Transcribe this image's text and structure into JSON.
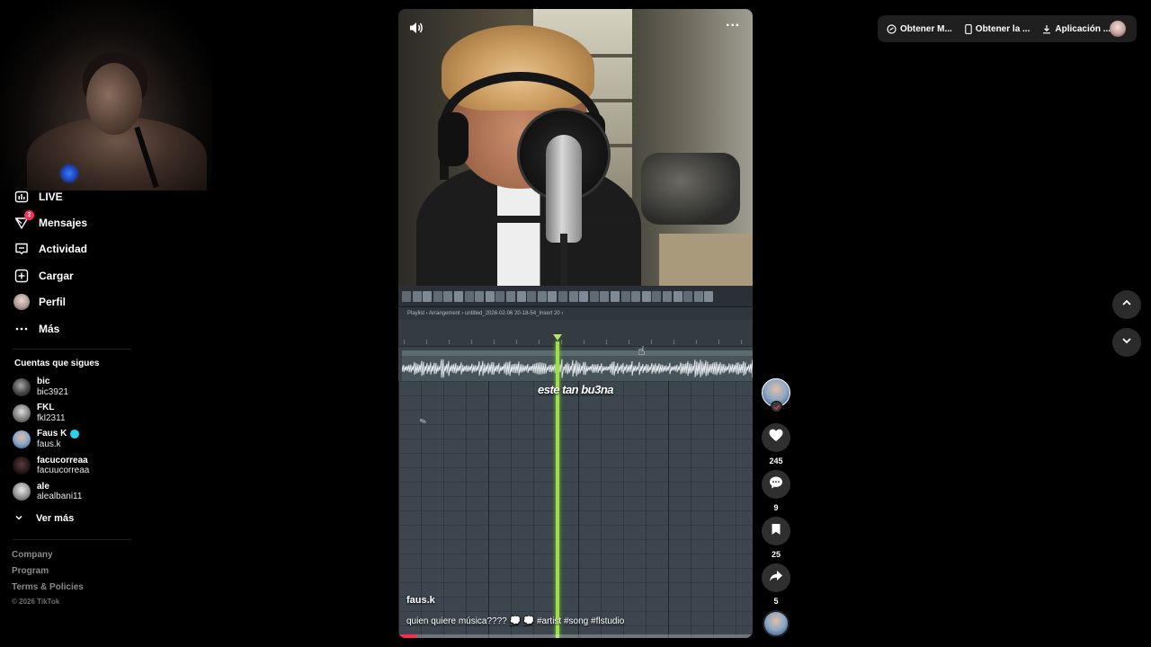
{
  "sidebar": {
    "nav": [
      {
        "label": "LIVE",
        "icon": "live-icon"
      },
      {
        "label": "Mensajes",
        "icon": "messages-icon",
        "badge": "2"
      },
      {
        "label": "Actividad",
        "icon": "activity-icon"
      },
      {
        "label": "Cargar",
        "icon": "upload-icon"
      },
      {
        "label": "Perfil",
        "icon": "profile-avatar"
      },
      {
        "label": "Más",
        "icon": "more-icon"
      }
    ],
    "following_title": "Cuentas que sigues",
    "following": [
      {
        "name": "bic",
        "username": "bic3921",
        "verified": false
      },
      {
        "name": "FKL",
        "username": "fkl2311",
        "verified": false
      },
      {
        "name": "Faus K",
        "username": "faus.k",
        "verified": true
      },
      {
        "name": "facucorreaa",
        "username": "facuucorreaa",
        "verified": false
      },
      {
        "name": "ale",
        "username": "alealbani11",
        "verified": false
      }
    ],
    "see_more": "Ver más",
    "footer_links": [
      "Company",
      "Program",
      "Terms & Policies"
    ],
    "copyright": "© 2026 TikTok"
  },
  "video": {
    "daw_title": "Playlist › Arrangement › untitled_2026-02-06 20-18-54_Insert 20 ›",
    "caption_overlay": "este tan bu3na",
    "author": "faus.k",
    "description": "quien quiere música???? 💭 💭 #artist #song #flstudio",
    "progress": 0.05
  },
  "actions": {
    "likes": "245",
    "comments": "9",
    "saves": "25",
    "shares": "5"
  },
  "topbar": {
    "btn1": "Obtener M...",
    "btn2": "Obtener la ...",
    "btn3": "Aplicación ..."
  },
  "colors": {
    "accent": "#fe2c55",
    "verified": "#20d5ec",
    "playhead": "#9be04a"
  }
}
